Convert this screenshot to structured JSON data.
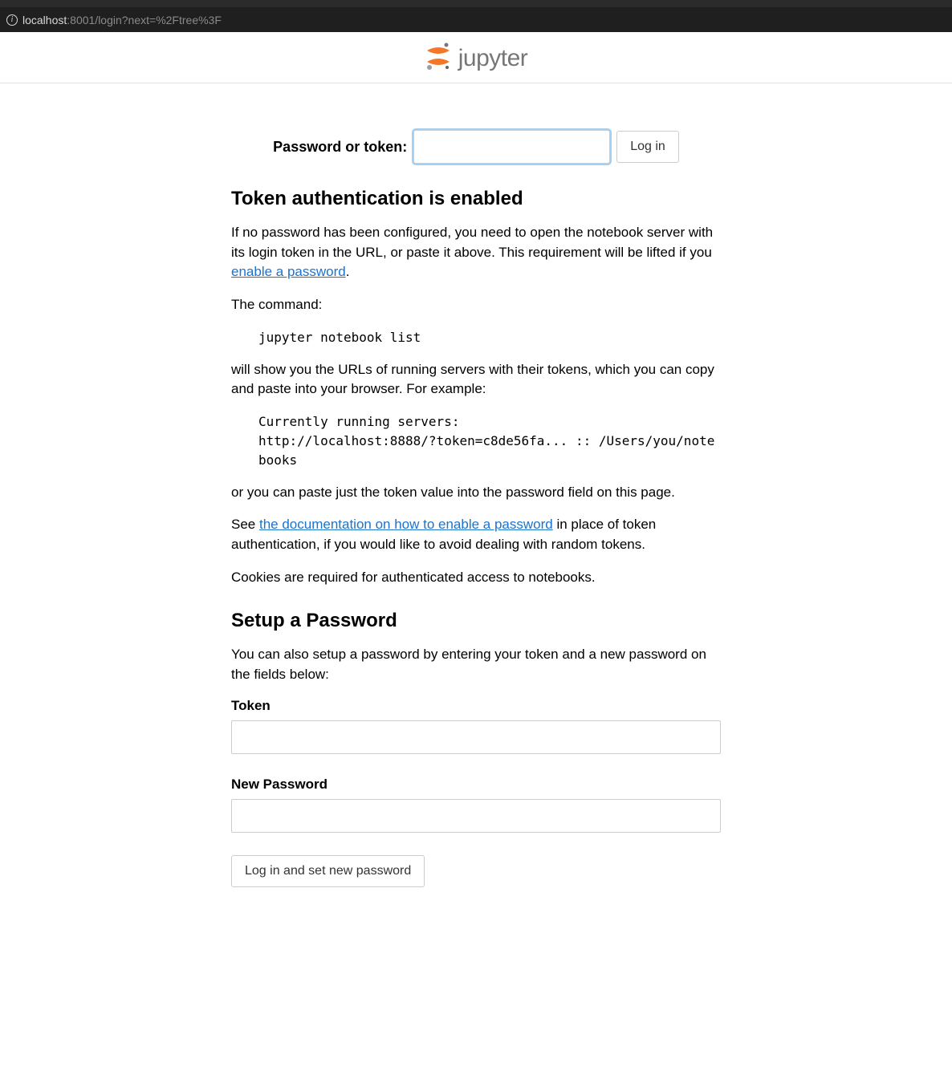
{
  "browser": {
    "url_host": "localhost",
    "url_path": ":8001/login?next=%2Ftree%3F"
  },
  "logo": {
    "text": "jupyter"
  },
  "login": {
    "label": "Password or token:",
    "button": "Log in"
  },
  "section1": {
    "heading": "Token authentication is enabled",
    "p1a": "If no password has been configured, you need to open the notebook server with its login token in the URL, or paste it above. This requirement will be lifted if you ",
    "p1_link": "enable a password",
    "p1b": ".",
    "p2": "The command:",
    "code1": "jupyter notebook list",
    "p3": "will show you the URLs of running servers with their tokens, which you can copy and paste into your browser. For example:",
    "code2": "Currently running servers:\nhttp://localhost:8888/?token=c8de56fa... :: /Users/you/notebooks",
    "p4": "or you can paste just the token value into the password field on this page.",
    "p5a": "See ",
    "p5_link": "the documentation on how to enable a password",
    "p5b": " in place of token authentication, if you would like to avoid dealing with random tokens.",
    "p6": "Cookies are required for authenticated access to notebooks."
  },
  "section2": {
    "heading": "Setup a Password",
    "p1": "You can also setup a password by entering your token and a new password on the fields below:",
    "token_label": "Token",
    "newpw_label": "New Password",
    "button": "Log in and set new password"
  }
}
